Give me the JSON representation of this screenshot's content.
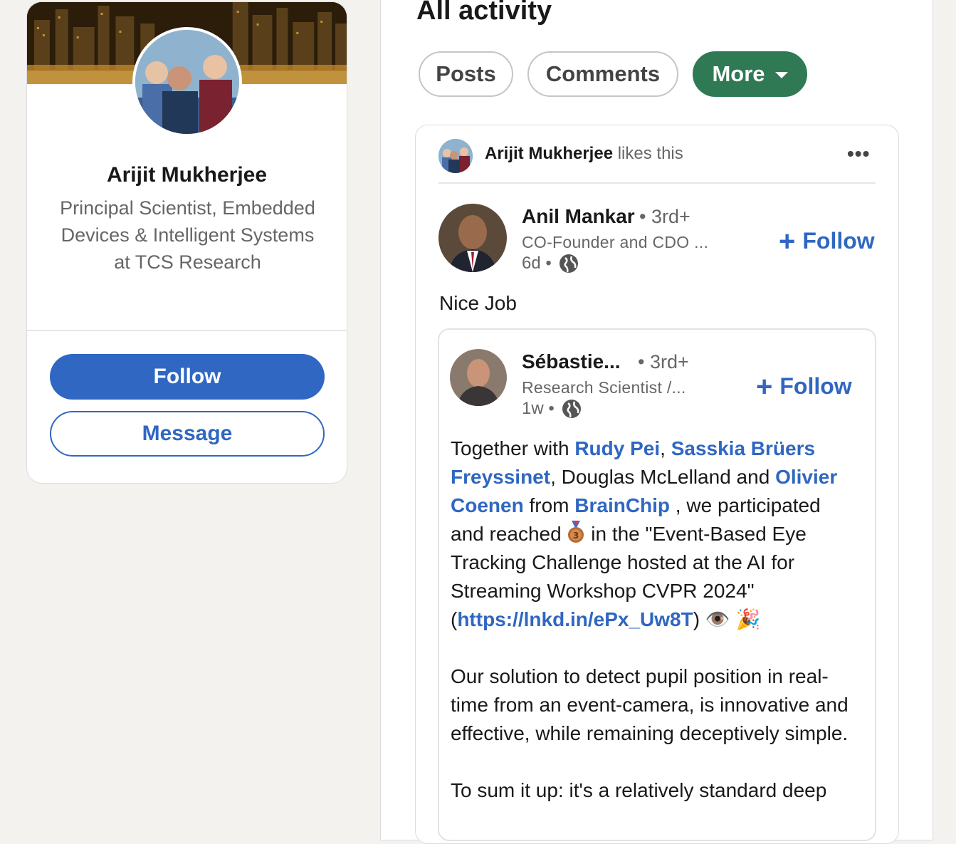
{
  "profile": {
    "name": "Arijit Mukherjee",
    "headline": "Principal Scientist, Embedded Devices & Intelligent Systems at TCS Research",
    "follow_label": "Follow",
    "message_label": "Message"
  },
  "activity": {
    "title": "All activity",
    "filters": [
      "Posts",
      "Comments",
      "More"
    ]
  },
  "post": {
    "liker_name": "Arijit Mukherjee",
    "liker_action": "likes this",
    "more_label": "•••",
    "author": {
      "name": "Anil Mankar",
      "degree": "• 3rd+",
      "subtitle": "CO-Founder and CDO ...",
      "time": "6d •",
      "follow_label": "Follow"
    },
    "comment": "Nice Job",
    "shared": {
      "author": {
        "name": "Sébastie...",
        "degree": "• 3rd+",
        "subtitle": "Research Scientist /...",
        "time": "1w •",
        "follow_label": "Follow"
      },
      "body": {
        "t1": "Together with ",
        "m1": "Rudy Pei",
        "t2": ", ",
        "m2": "Sasskia Brüers Freyssinet",
        "t3": ", Douglas McLelland and ",
        "m3": "Olivier Coenen",
        "t4": " from ",
        "m4": "BrainChip",
        "t5": " , we participated and reached ",
        "t6": " in the \"Event-Based Eye Tracking Challenge hosted at the AI for Streaming Workshop CVPR 2024\" (",
        "link": "https://lnkd.in/ePx_Uw8T",
        "t7": ") 👁️ 🎉",
        "p2": "Our solution to detect pupil position in real-time from an event-camera, is innovative and effective, while remaining deceptively simple.",
        "p3": "To sum it up: it's a relatively standard deep"
      }
    }
  },
  "colors": {
    "brand_blue": "#2f67c2",
    "more_green": "#2f7a55",
    "background": "#f3f2ef"
  }
}
